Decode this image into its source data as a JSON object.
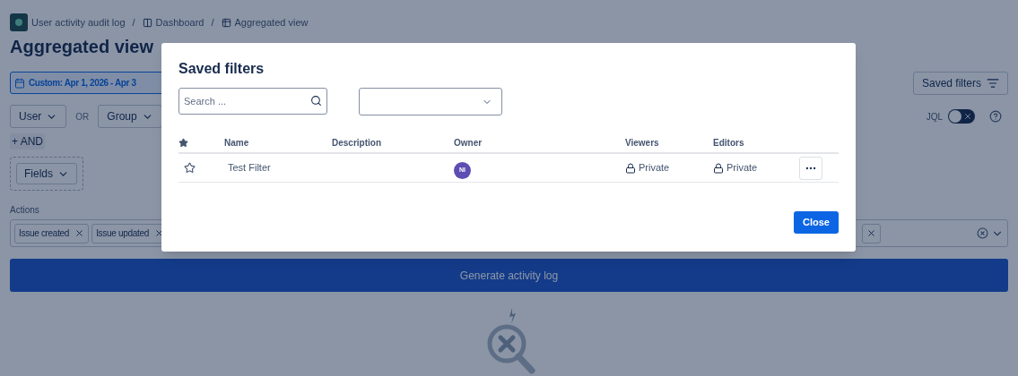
{
  "breadcrumbs": [
    {
      "kind": "app",
      "label": "User activity audit log"
    },
    {
      "kind": "dashboard",
      "separator": "/",
      "label": "Dashboard"
    },
    {
      "kind": "table",
      "separator": "/",
      "label": "Aggregated view"
    }
  ],
  "title": "Aggregated view",
  "date_range": "Custom: Apr 1, 2026 - Apr 3",
  "saved_filters_button": "Saved filters",
  "filters": {
    "user": "User",
    "or": "OR",
    "group": "Group",
    "and": "+ AND",
    "fields": "Fields"
  },
  "jql": {
    "label": "JQL",
    "on": false
  },
  "actions": {
    "label": "Actions",
    "tags": [
      "Issue created",
      "Issue updated"
    ]
  },
  "generate_button": "Generate activity log",
  "modal": {
    "title": "Saved filters",
    "search": {
      "placeholder": "Search ..."
    },
    "columns": [
      "Name",
      "Description",
      "Owner",
      "Viewers",
      "Editors"
    ],
    "rows": [
      {
        "starred": false,
        "name": "Test Filter",
        "owner_initials": "NI",
        "viewers": "Private",
        "editors": "Private"
      }
    ],
    "close_button": "Close"
  }
}
